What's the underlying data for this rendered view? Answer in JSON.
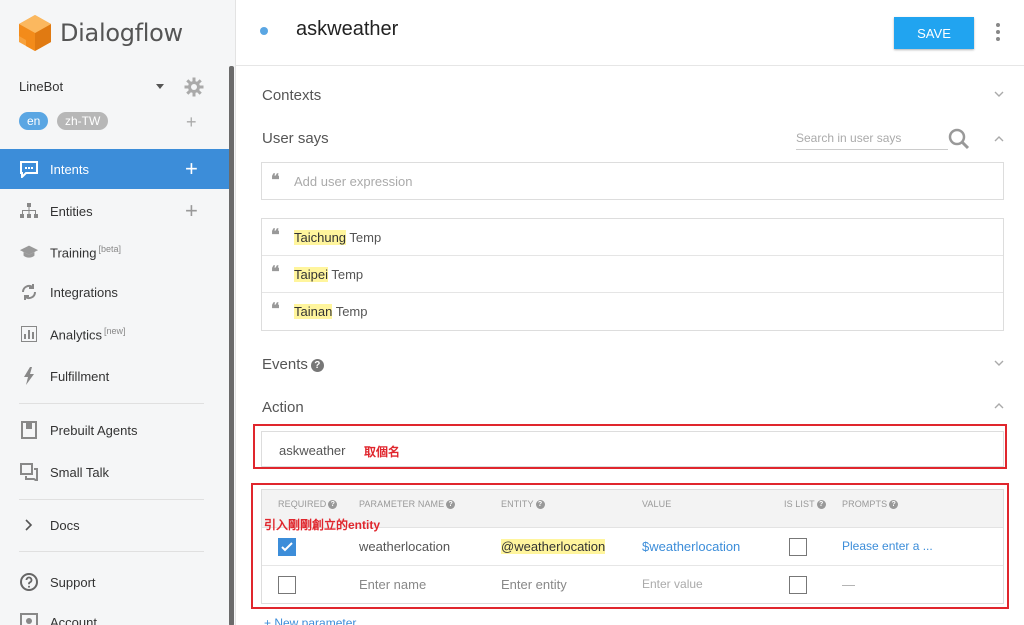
{
  "brand": {
    "name": "Dialogflow",
    "accent": "#3c8dd9",
    "logo_color": "#f38b1a"
  },
  "agent": {
    "name": "LineBot",
    "languages": [
      "en",
      "zh-TW"
    ]
  },
  "nav": [
    {
      "label": "Intents",
      "icon": "chat-bubble-icon",
      "active": true
    },
    {
      "label": "Entities",
      "icon": "sitemap-icon"
    },
    {
      "label": "Training",
      "badge": "[beta]",
      "icon": "graduation-cap-icon"
    },
    {
      "label": "Integrations",
      "icon": "sync-icon"
    },
    {
      "label": "Analytics",
      "badge": "[new]",
      "icon": "bar-chart-icon"
    },
    {
      "label": "Fulfillment",
      "icon": "lightning-icon"
    },
    {
      "label": "Prebuilt Agents",
      "icon": "book-icon"
    },
    {
      "label": "Small Talk",
      "icon": "speech-bubbles-icon"
    },
    {
      "label": "Docs",
      "icon": "chevron-right-icon"
    },
    {
      "label": "Support",
      "icon": "help-circle-icon"
    },
    {
      "label": "Account",
      "icon": "account-icon"
    }
  ],
  "header": {
    "intent_name": "askweather",
    "save_label": "SAVE"
  },
  "sections": {
    "contexts": "Contexts",
    "user_says": "User says",
    "events": "Events",
    "action": "Action"
  },
  "user_says": {
    "search_placeholder": "Search in user says",
    "add_placeholder": "Add user expression",
    "examples": [
      {
        "entity": "Taichung",
        "rest": " Temp"
      },
      {
        "entity": "Taipei",
        "rest": " Temp"
      },
      {
        "entity": "Tainan",
        "rest": " Temp"
      }
    ]
  },
  "action": {
    "value": "askweather",
    "annotation": "取個名"
  },
  "parameters": {
    "annotation": "引入剛剛創立的entity",
    "headers": [
      "REQUIRED",
      "PARAMETER NAME",
      "ENTITY",
      "VALUE",
      "IS LIST",
      "PROMPTS"
    ],
    "rows": [
      {
        "required": true,
        "name": "weatherlocation",
        "entity": "@weatherlocation",
        "value": "$weatherlocation",
        "is_list": false,
        "prompts": "Please enter a ..."
      },
      {
        "required": false,
        "name": "Enter name",
        "entity": "Enter entity",
        "value": "Enter value",
        "is_list": false,
        "prompts": "—"
      }
    ],
    "new_label": "New parameter"
  }
}
